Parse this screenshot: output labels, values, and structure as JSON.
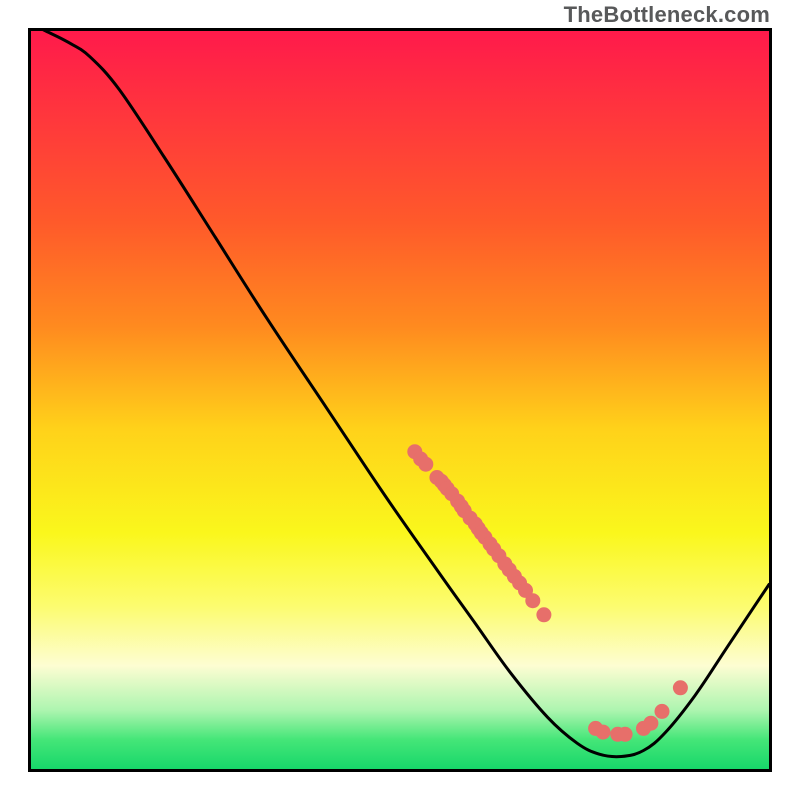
{
  "watermark": "TheBottleneck.com",
  "chart_data": {
    "type": "line",
    "title": "",
    "xlabel": "",
    "ylabel": "",
    "xlim": [
      0,
      100
    ],
    "ylim": [
      0,
      100
    ],
    "grid": false,
    "legend": false,
    "gradient_stops": [
      {
        "y": 100,
        "color": "#ff1a4b"
      },
      {
        "y": 74,
        "color": "#ff5a2a"
      },
      {
        "y": 60,
        "color": "#ff8a1f"
      },
      {
        "y": 46,
        "color": "#ffd21a"
      },
      {
        "y": 32,
        "color": "#faf71c"
      },
      {
        "y": 22,
        "color": "#fcfc70"
      },
      {
        "y": 14,
        "color": "#fdfdd2"
      },
      {
        "y": 8,
        "color": "#aef5b0"
      },
      {
        "y": 4,
        "color": "#45e678"
      },
      {
        "y": 0,
        "color": "#17d76a"
      }
    ],
    "curve": [
      {
        "x": 0,
        "y": 101
      },
      {
        "x": 2,
        "y": 100
      },
      {
        "x": 5,
        "y": 98.5
      },
      {
        "x": 8,
        "y": 96.5
      },
      {
        "x": 12,
        "y": 92
      },
      {
        "x": 18,
        "y": 83
      },
      {
        "x": 25,
        "y": 72
      },
      {
        "x": 32,
        "y": 61
      },
      {
        "x": 40,
        "y": 49
      },
      {
        "x": 48,
        "y": 37
      },
      {
        "x": 55,
        "y": 27
      },
      {
        "x": 60,
        "y": 20
      },
      {
        "x": 65,
        "y": 13
      },
      {
        "x": 70,
        "y": 7
      },
      {
        "x": 74,
        "y": 3.5
      },
      {
        "x": 77,
        "y": 2
      },
      {
        "x": 80,
        "y": 1.7
      },
      {
        "x": 83,
        "y": 2.5
      },
      {
        "x": 86,
        "y": 5
      },
      {
        "x": 90,
        "y": 10
      },
      {
        "x": 94,
        "y": 16
      },
      {
        "x": 98,
        "y": 22
      },
      {
        "x": 100,
        "y": 25
      }
    ],
    "dots": [
      {
        "x": 52,
        "y": 43
      },
      {
        "x": 52.8,
        "y": 42
      },
      {
        "x": 53.5,
        "y": 41.3
      },
      {
        "x": 55,
        "y": 39.5
      },
      {
        "x": 55.6,
        "y": 39
      },
      {
        "x": 56,
        "y": 38.5
      },
      {
        "x": 56.4,
        "y": 38
      },
      {
        "x": 57,
        "y": 37.3
      },
      {
        "x": 57.8,
        "y": 36.3
      },
      {
        "x": 58.3,
        "y": 35.6
      },
      {
        "x": 58.7,
        "y": 35
      },
      {
        "x": 59.5,
        "y": 34
      },
      {
        "x": 60.2,
        "y": 33.2
      },
      {
        "x": 60.6,
        "y": 32.6
      },
      {
        "x": 61,
        "y": 32
      },
      {
        "x": 61.5,
        "y": 31.4
      },
      {
        "x": 62.2,
        "y": 30.5
      },
      {
        "x": 62.7,
        "y": 29.8
      },
      {
        "x": 63.4,
        "y": 28.9
      },
      {
        "x": 64.2,
        "y": 27.8
      },
      {
        "x": 64.8,
        "y": 27
      },
      {
        "x": 65.5,
        "y": 26.1
      },
      {
        "x": 66.2,
        "y": 25.2
      },
      {
        "x": 67,
        "y": 24.2
      },
      {
        "x": 68,
        "y": 22.8
      },
      {
        "x": 69.5,
        "y": 20.9
      },
      {
        "x": 76.5,
        "y": 5.5
      },
      {
        "x": 77.5,
        "y": 5
      },
      {
        "x": 79.5,
        "y": 4.7
      },
      {
        "x": 80.5,
        "y": 4.7
      },
      {
        "x": 83,
        "y": 5.5
      },
      {
        "x": 84,
        "y": 6.2
      },
      {
        "x": 85.5,
        "y": 7.8
      },
      {
        "x": 88,
        "y": 11
      }
    ],
    "styles": {
      "line_color": "#000000",
      "line_width": 3,
      "dot_color": "#e76f6a",
      "dot_radius": 7.5
    }
  }
}
